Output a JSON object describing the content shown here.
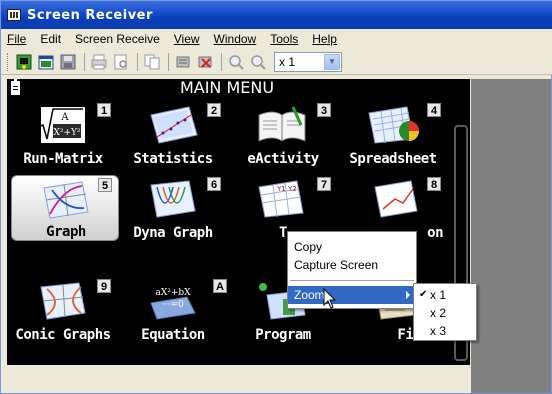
{
  "window": {
    "title": "Screen Receiver"
  },
  "menubar": {
    "items": [
      {
        "label": "File"
      },
      {
        "label": "Edit"
      },
      {
        "label": "Screen Receive"
      },
      {
        "label": "View"
      },
      {
        "label": "Window"
      },
      {
        "label": "Tools"
      },
      {
        "label": "Help"
      }
    ]
  },
  "toolbar": {
    "zoom_value": "x 1"
  },
  "screen": {
    "title": "MAIN MENU",
    "apps": [
      {
        "num": "1",
        "label": "Run-Matrix",
        "icon": "run-matrix-icon"
      },
      {
        "num": "2",
        "label": "Statistics",
        "icon": "statistics-icon"
      },
      {
        "num": "3",
        "label": "eActivity",
        "icon": "eactivity-icon"
      },
      {
        "num": "4",
        "label": "Spreadsheet",
        "icon": "spreadsheet-icon"
      },
      {
        "num": "5",
        "label": "Graph",
        "icon": "graph-icon"
      },
      {
        "num": "6",
        "label": "Dyna Graph",
        "icon": "dyna-graph-icon"
      },
      {
        "num": "7",
        "label": "T",
        "icon": "table-icon"
      },
      {
        "num": "8",
        "label": "on",
        "icon": "recursion-icon"
      },
      {
        "num": "9",
        "label": "Conic Graphs",
        "icon": "conic-graphs-icon"
      },
      {
        "num": "A",
        "label": "Equation",
        "icon": "equation-icon"
      },
      {
        "num": "",
        "label": "Program",
        "icon": "program-icon"
      },
      {
        "num": "",
        "label": "Financ",
        "icon": "financial-icon"
      }
    ],
    "run_matrix_formula": "A / X²+Y²",
    "equation_formula": "aXⁿ+bXⁿ⁻¹ ···=0"
  },
  "context_menu": {
    "copy": "Copy",
    "capture": "Capture Screen",
    "zoom": "Zoom"
  },
  "zoom_submenu": {
    "items": [
      "x 1",
      "x 2",
      "x 3"
    ],
    "checked": "x 1"
  },
  "colors": {
    "titlebar": "#0a3fbf",
    "menu_highlight": "#316ac5",
    "screen_bg": "#000000",
    "right_pane": "#808080"
  }
}
